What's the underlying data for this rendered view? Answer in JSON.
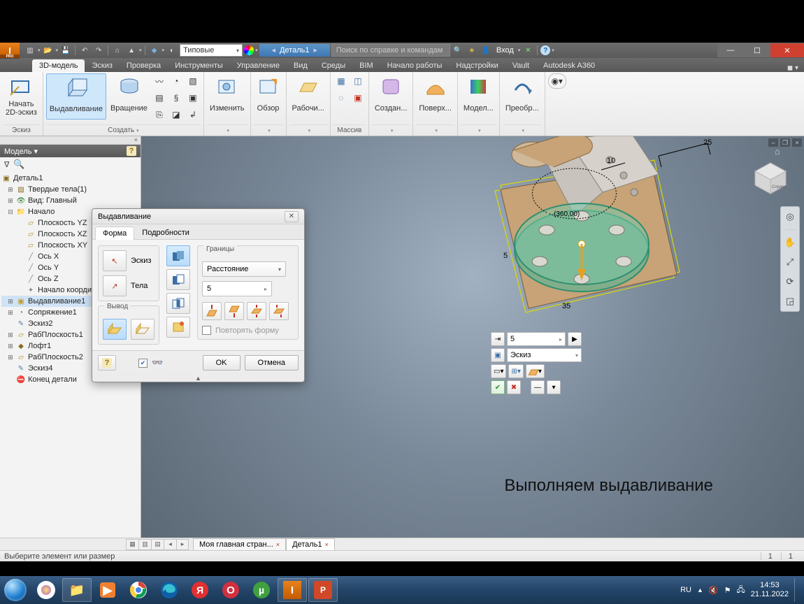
{
  "titlebar": {
    "style_dropdown": "Типовые",
    "document": "Деталь1",
    "search_placeholder": "Поиск по справке и командам",
    "login": "Вход"
  },
  "ribbon_tabs": [
    "3D-модель",
    "Эскиз",
    "Проверка",
    "Инструменты",
    "Управление",
    "Вид",
    "Среды",
    "BIM",
    "Начало работы",
    "Надстройки",
    "Vault",
    "Autodesk A360"
  ],
  "ribbon": {
    "panel_sketch": {
      "title": "Эскиз",
      "start_sketch": "Начать\n2D-эскиз"
    },
    "panel_create": {
      "title": "Создать",
      "extrude": "Выдавливание",
      "revolve": "Вращение"
    },
    "panel_modify": {
      "title": "",
      "modify": "Изменить"
    },
    "panel_explore": {
      "explore": "Обзор"
    },
    "panel_workfeat": {
      "work": "Рабочи..."
    },
    "panel_pattern": {
      "title": "Массив"
    },
    "panel_freeform": {
      "create": "Создан..."
    },
    "panel_surface": {
      "surface": "Поверх..."
    },
    "panel_simulate": {
      "model": "Модел..."
    },
    "panel_convert": {
      "convert": "Преобр..."
    }
  },
  "browser": {
    "header": "Модель",
    "root": "Деталь1",
    "items": [
      {
        "depth": 0,
        "tw": "⊞",
        "icon": "cube",
        "label": "Твердые тела(1)",
        "color": "#8a6a1d"
      },
      {
        "depth": 0,
        "tw": "⊞",
        "icon": "view",
        "label": "Вид: Главный",
        "color": "#2a7a2a"
      },
      {
        "depth": 0,
        "tw": "⊟",
        "icon": "folder",
        "label": "Начало",
        "color": "#b58a1d"
      },
      {
        "depth": 1,
        "tw": "",
        "icon": "plane",
        "label": "Плоскость YZ",
        "color": "#b58a1d"
      },
      {
        "depth": 1,
        "tw": "",
        "icon": "plane",
        "label": "Плоскость XZ",
        "color": "#b58a1d"
      },
      {
        "depth": 1,
        "tw": "",
        "icon": "plane",
        "label": "Плоскость XY",
        "color": "#b58a1d"
      },
      {
        "depth": 1,
        "tw": "",
        "icon": "axis",
        "label": "Ось X",
        "color": "#888"
      },
      {
        "depth": 1,
        "tw": "",
        "icon": "axis",
        "label": "Ось Y",
        "color": "#888"
      },
      {
        "depth": 1,
        "tw": "",
        "icon": "axis",
        "label": "Ось Z",
        "color": "#888"
      },
      {
        "depth": 1,
        "tw": "",
        "icon": "pt",
        "label": "Начало координ...",
        "color": "#888"
      },
      {
        "depth": 0,
        "tw": "⊞",
        "icon": "feat",
        "label": "Выдавливание1",
        "color": "#c79a2f",
        "sel": true
      },
      {
        "depth": 0,
        "tw": "⊞",
        "icon": "fillet",
        "label": "Сопряжение1",
        "color": "#8a6a1d"
      },
      {
        "depth": 0,
        "tw": "",
        "icon": "sketch",
        "label": "Эскиз2",
        "color": "#5a7fa6"
      },
      {
        "depth": 0,
        "tw": "⊞",
        "icon": "plane",
        "label": "РабПлоскость1",
        "color": "#b58a1d"
      },
      {
        "depth": 0,
        "tw": "⊞",
        "icon": "loft",
        "label": "Лофт1",
        "color": "#8a6a1d"
      },
      {
        "depth": 0,
        "tw": "⊞",
        "icon": "plane",
        "label": "РабПлоскость2",
        "color": "#b58a1d"
      },
      {
        "depth": 0,
        "tw": "",
        "icon": "sketch",
        "label": "Эскиз4",
        "color": "#5a7fa6"
      },
      {
        "depth": 0,
        "tw": "",
        "icon": "end",
        "label": "Конец детали",
        "color": "#c03020"
      }
    ]
  },
  "dialog": {
    "title": "Выдавливание",
    "tab_shape": "Форма",
    "tab_more": "Подробности",
    "grp_profile_sketch": "Эскиз",
    "grp_profile_solids": "Тела",
    "grp_output": "Вывод",
    "grp_extents": "Границы",
    "extents_mode": "Расстояние",
    "distance": "5",
    "match_shape": "Повторять форму",
    "ok": "OK",
    "cancel": "Отмена"
  },
  "mini": {
    "distance": "5",
    "profile": "Эскиз"
  },
  "annotation": "Выполняем выдавливание",
  "dims": {
    "d1": "10",
    "d2": "25",
    "d3": "5",
    "d4": "35",
    "ang": "(360,00)"
  },
  "doctabs": {
    "main": "Моя главная стран...",
    "part": "Деталь1"
  },
  "status": {
    "prompt": "Выберите элемент или размер",
    "n1": "1",
    "n2": "1"
  },
  "taskbar": {
    "lang": "RU",
    "time": "14:53",
    "date": "21.11.2022"
  }
}
